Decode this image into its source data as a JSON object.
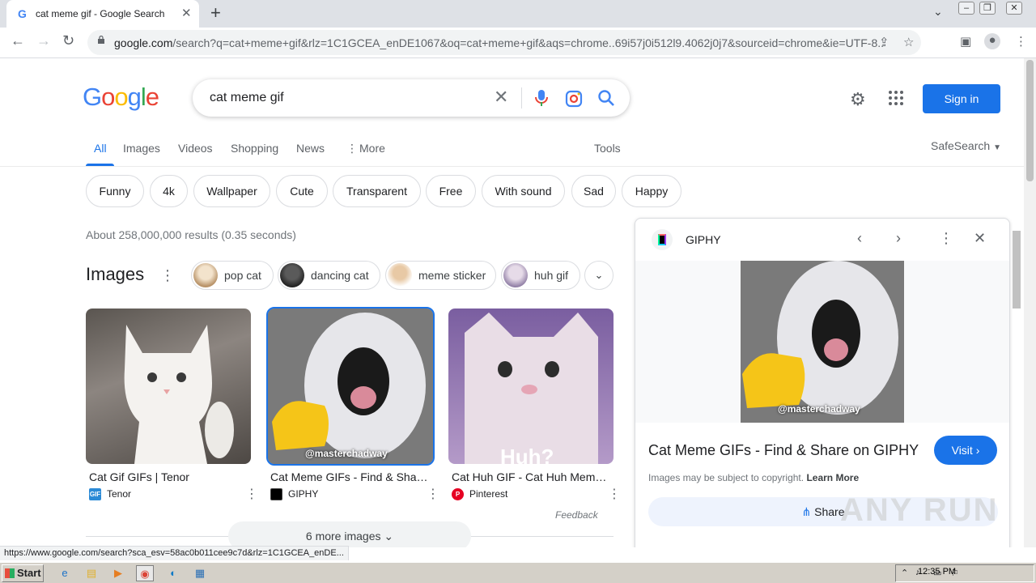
{
  "browser": {
    "tab_title": "cat meme gif - Google Search",
    "tab_favicon": "G",
    "new_tab": "+",
    "url_host": "google.com",
    "url_rest": "/search?q=cat+meme+gif&rlz=1C1GCEA_enDE1067&oq=cat+meme+gif&aqs=chrome..69i57j0i512l9.4062j0j7&sourceid=chrome&ie=UTF-8...",
    "status_url": "https://www.google.com/search?sca_esv=58ac0b011cee9c7d&rlz=1C1GCEA_enDE..."
  },
  "header": {
    "logo": [
      "G",
      "o",
      "o",
      "g",
      "l",
      "e"
    ],
    "logo_colors": [
      "#4285f4",
      "#ea4335",
      "#fbbc05",
      "#4285f4",
      "#34a853",
      "#ea4335"
    ],
    "query": "cat meme gif",
    "sign_in": "Sign in"
  },
  "nav": {
    "tabs": [
      "All",
      "Images",
      "Videos",
      "Shopping",
      "News",
      "More"
    ],
    "tools": "Tools",
    "safesearch": "SafeSearch"
  },
  "chips": [
    "Funny",
    "4k",
    "Wallpaper",
    "Cute",
    "Transparent",
    "Free",
    "With sound",
    "Sad",
    "Happy"
  ],
  "results": {
    "stats": "About 258,000,000 results (0.35 seconds)",
    "images_heading": "Images",
    "related": [
      "pop cat",
      "dancing cat",
      "meme sticker",
      "huh gif"
    ],
    "cards": [
      {
        "title": "Cat Gif GIFs | Tenor",
        "source": "Tenor",
        "fav": "GIF"
      },
      {
        "title": "Cat Meme GIFs - Find & Share on GIPHY",
        "source": "GIPHY",
        "fav": ""
      },
      {
        "title": "Cat Huh GIF - Cat Huh Meme GIFs",
        "source": "Pinterest",
        "fav": "P"
      }
    ],
    "watermark_credit": "@masterchadway",
    "huh_text": "Huh?",
    "feedback": "Feedback",
    "more_images": "6 more images"
  },
  "panel": {
    "source": "GIPHY",
    "title": "Cat Meme GIFs - Find & Share on GIPHY",
    "visit": "Visit",
    "copyright": "Images may be subject to copyright.",
    "learn_more": "Learn More",
    "share": "Share",
    "image_credit": "@masterchadway"
  },
  "watermark": "ANY RUN",
  "taskbar": {
    "start": "Start",
    "clock": "12:35 PM"
  },
  "colors": {
    "accent": "#1a73e8",
    "giphy_bg": "#000000",
    "pinterest": "#e60023",
    "tenor": "#2b8ad6"
  }
}
